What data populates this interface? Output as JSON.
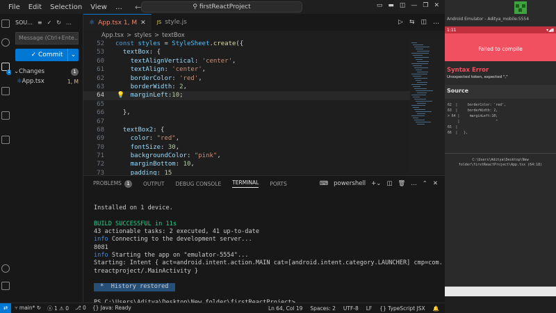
{
  "menu": [
    "File",
    "Edit",
    "Selection",
    "View"
  ],
  "title_search": "firstReactProject",
  "window_controls": [
    "minimize",
    "restore",
    "close"
  ],
  "sidebar": {
    "title": "SOU...",
    "message_placeholder": "Message (Ctrl+Ente...",
    "commit_label": "Commit",
    "changes_label": "Changes",
    "changes_count": "1",
    "file_name": "App.tsx",
    "file_status": "1, M"
  },
  "tabs": [
    {
      "label": "App.tsx  1, M",
      "icon": "react-icon",
      "active": true
    },
    {
      "label": "style.js",
      "icon": "js-icon",
      "active": false
    }
  ],
  "breadcrumb": [
    "App.tsx",
    ">",
    "styles",
    ">",
    "textBox"
  ],
  "code": [
    {
      "n": "52",
      "html": "<span class='k'>const</span> <span class='v'>styles</span> <span class='w'>=</span> <span class='v'>StyleSheet</span><span class='w'>.</span><span class='f'>create</span><span class='w'>({</span>"
    },
    {
      "n": "53",
      "html": "  <span class='p'>textBox</span><span class='w'>: {</span>"
    },
    {
      "n": "60",
      "html": "    <span class='p'>textAlignVertical</span><span class='w'>: </span><span class='s'>'center'</span><span class='w'>,</span>"
    },
    {
      "n": "61",
      "html": "    <span class='p'>textAlign</span><span class='w'>: </span><span class='s'>'center'</span><span class='w'>,</span>"
    },
    {
      "n": "62",
      "html": "    <span class='p'>borderColor</span><span class='w'>: </span><span class='s'>'red'</span><span class='w'>,</span>"
    },
    {
      "n": "63",
      "html": "    <span class='p'>borderWidth</span><span class='w'>: </span><span class='n'>2</span><span class='w'>,</span>"
    },
    {
      "n": "64",
      "html": "    <span class='p'>marginLeft</span><span class='w'>:</span><span class='n'>10</span><span class='w'>;</span>",
      "current": true
    },
    {
      "n": "65",
      "html": ""
    },
    {
      "n": "66",
      "html": "  <span class='w'>},</span>"
    },
    {
      "n": "67",
      "html": ""
    },
    {
      "n": "68",
      "html": "  <span class='p'>textBox2</span><span class='w'>: {</span>"
    },
    {
      "n": "69",
      "html": "    <span class='p'>color</span><span class='w'>: </span><span class='s'>\"red\"</span><span class='w'>,</span>"
    },
    {
      "n": "70",
      "html": "    <span class='p'>fontSize</span><span class='w'>: </span><span class='n'>30</span><span class='w'>,</span>"
    },
    {
      "n": "71",
      "html": "    <span class='p'>backgroundColor</span><span class='w'>: </span><span class='s'>\"pink\"</span><span class='w'>,</span>"
    },
    {
      "n": "72",
      "html": "    <span class='p'>marginBottom</span><span class='w'>: </span><span class='n'>10</span><span class='w'>,</span>"
    },
    {
      "n": "73",
      "html": "    <span class='p'>padding</span><span class='w'>: </span><span class='n'>15</span>"
    }
  ],
  "panel": {
    "tabs": [
      "PROBLEMS",
      "OUTPUT",
      "DEBUG CONSOLE",
      "TERMINAL",
      "PORTS"
    ],
    "problems_count": "1",
    "shell": "powershell"
  },
  "terminal": [
    {
      "cls": "",
      "text": ""
    },
    {
      "cls": "",
      "text": "Installed on 1 device."
    },
    {
      "cls": "",
      "text": ""
    },
    {
      "cls": "green",
      "text": "BUILD SUCCESSFUL in 11s"
    },
    {
      "cls": "",
      "text": "43 actionable tasks: 2 executed, 41 up-to-date"
    },
    {
      "cls": "blue",
      "prefix": "info",
      "text": " Connecting to the development server..."
    },
    {
      "cls": "",
      "text": "8081"
    },
    {
      "cls": "blue",
      "prefix": "info",
      "text": " Starting the app on \"emulator-5554\"..."
    },
    {
      "cls": "",
      "text": "Starting: Intent { act=android.intent.action.MAIN cat=[android.intent.category.LAUNCHER] cmp=com."
    },
    {
      "cls": "",
      "text": "treactproject/.MainActivity }"
    },
    {
      "cls": "",
      "text": ""
    },
    {
      "cls": "hist",
      "text": " *  History restored "
    },
    {
      "cls": "",
      "text": ""
    },
    {
      "cls": "",
      "text": "PS C:\\Users\\Aditya\\Desktop\\New folder\\firstReactProject> "
    }
  ],
  "status": {
    "branch": "main*",
    "errors": "ⓧ 1 ⚠ 0",
    "ports": "⎇ 0",
    "java": "Java: Ready",
    "position": "Ln 64, Col 19",
    "spaces": "Spaces: 2",
    "encoding": "UTF-8",
    "eol": "LF",
    "language": "{} TypeScript JSX"
  },
  "emulator": {
    "title": "Android Emulator - Aditya_mobile:5554",
    "time": "1:11",
    "banner": "Failed to compile",
    "error_title": "Syntax Error",
    "error_msg": "Unexpected token, expected \",\"",
    "source_label": "Source",
    "mini_code": [
      "62  |     borderColor: 'red',",
      "63  |     borderWidth: 2,",
      "> 64 |     marginLeft:10;",
      "     |                  ^",
      "65  |",
      "66  |   },"
    ],
    "path": "C:\\Users\\Aditya\\Desktop\\New\nfolder\\firstReactProject\\App.tsx (64:18)"
  }
}
